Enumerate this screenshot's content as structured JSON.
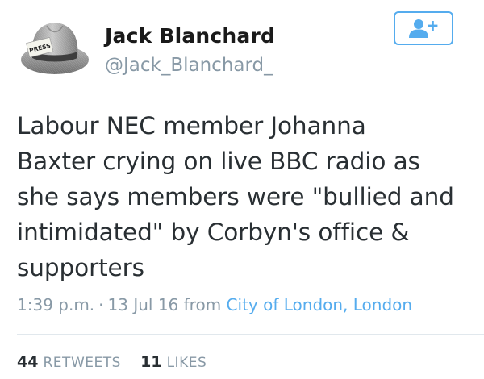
{
  "profile": {
    "name": "Jack Blanchard",
    "handle": "@Jack_Blanchard_",
    "avatar_badge": "PRESS"
  },
  "follow_button": {
    "icon": "add-user-icon",
    "color": "#55acee"
  },
  "tweet": {
    "lines": [
      "Labour NEC member Johanna",
      "Baxter crying on live BBC radio as",
      "she says members were \"bullied and",
      "intimidated\" by Corbyn's office &",
      "supporters"
    ]
  },
  "meta": {
    "time": "1:39 p.m.",
    "separator": "·",
    "date": "13 Jul 16",
    "from_label": "from",
    "location": "City of London, London"
  },
  "stats": {
    "retweets_count": "44",
    "retweets_label": "RETWEETS",
    "likes_count": "11",
    "likes_label": "LIKES"
  },
  "colors": {
    "accent": "#55acee",
    "muted": "#8899a6",
    "text": "#292f33"
  }
}
